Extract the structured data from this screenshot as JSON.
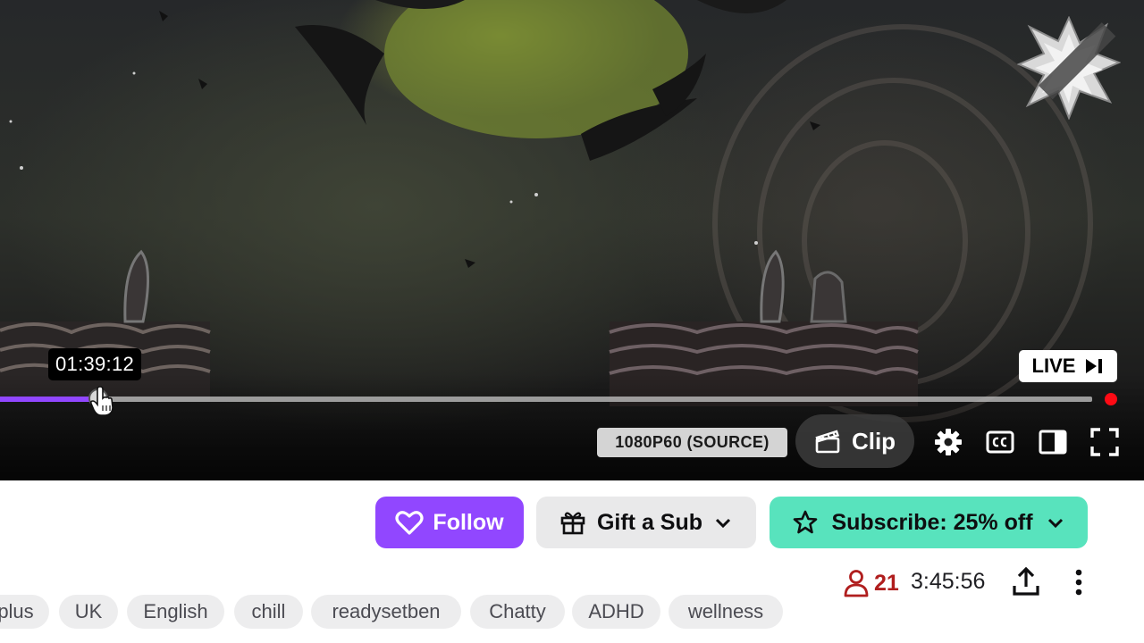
{
  "player": {
    "tooltip_time": "01:39:12",
    "live_label": "LIVE",
    "seek_progress": 0.09,
    "quality_label": "1080P60 (SOURCE)",
    "clip_label": "Clip",
    "icons": [
      "settings-icon",
      "closed-captions-icon",
      "theatre-mode-icon",
      "fullscreen-icon"
    ]
  },
  "actions": {
    "follow_label": "Follow",
    "gift_label": "Gift a Sub",
    "subscribe_label": "Subscribe: 25% off"
  },
  "stats": {
    "viewer_count": "21",
    "uptime": "3:45:56"
  },
  "tags": [
    "plus",
    "UK",
    "English",
    "chill",
    "readysetben",
    "Chatty",
    "ADHD",
    "wellness"
  ],
  "colors": {
    "brand_purple": "#9147ff",
    "subscribe_teal": "#58e3bd",
    "live_red": "#ff0a14",
    "viewer_red": "#b01e1e"
  }
}
